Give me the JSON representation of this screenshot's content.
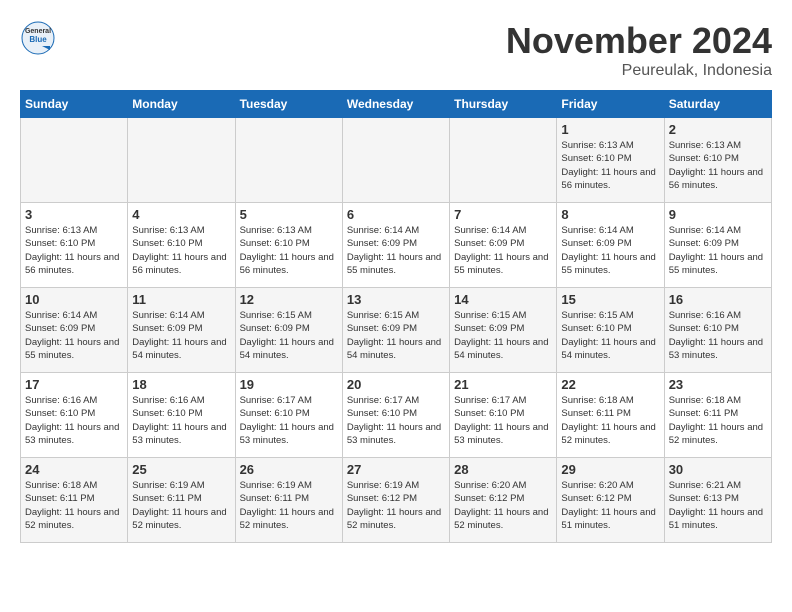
{
  "header": {
    "logo_general": "General",
    "logo_blue": "Blue",
    "month_title": "November 2024",
    "location": "Peureulak, Indonesia"
  },
  "days_of_week": [
    "Sunday",
    "Monday",
    "Tuesday",
    "Wednesday",
    "Thursday",
    "Friday",
    "Saturday"
  ],
  "weeks": [
    [
      {
        "day": "",
        "info": ""
      },
      {
        "day": "",
        "info": ""
      },
      {
        "day": "",
        "info": ""
      },
      {
        "day": "",
        "info": ""
      },
      {
        "day": "",
        "info": ""
      },
      {
        "day": "1",
        "info": "Sunrise: 6:13 AM\nSunset: 6:10 PM\nDaylight: 11 hours and 56 minutes."
      },
      {
        "day": "2",
        "info": "Sunrise: 6:13 AM\nSunset: 6:10 PM\nDaylight: 11 hours and 56 minutes."
      }
    ],
    [
      {
        "day": "3",
        "info": "Sunrise: 6:13 AM\nSunset: 6:10 PM\nDaylight: 11 hours and 56 minutes."
      },
      {
        "day": "4",
        "info": "Sunrise: 6:13 AM\nSunset: 6:10 PM\nDaylight: 11 hours and 56 minutes."
      },
      {
        "day": "5",
        "info": "Sunrise: 6:13 AM\nSunset: 6:10 PM\nDaylight: 11 hours and 56 minutes."
      },
      {
        "day": "6",
        "info": "Sunrise: 6:14 AM\nSunset: 6:09 PM\nDaylight: 11 hours and 55 minutes."
      },
      {
        "day": "7",
        "info": "Sunrise: 6:14 AM\nSunset: 6:09 PM\nDaylight: 11 hours and 55 minutes."
      },
      {
        "day": "8",
        "info": "Sunrise: 6:14 AM\nSunset: 6:09 PM\nDaylight: 11 hours and 55 minutes."
      },
      {
        "day": "9",
        "info": "Sunrise: 6:14 AM\nSunset: 6:09 PM\nDaylight: 11 hours and 55 minutes."
      }
    ],
    [
      {
        "day": "10",
        "info": "Sunrise: 6:14 AM\nSunset: 6:09 PM\nDaylight: 11 hours and 55 minutes."
      },
      {
        "day": "11",
        "info": "Sunrise: 6:14 AM\nSunset: 6:09 PM\nDaylight: 11 hours and 54 minutes."
      },
      {
        "day": "12",
        "info": "Sunrise: 6:15 AM\nSunset: 6:09 PM\nDaylight: 11 hours and 54 minutes."
      },
      {
        "day": "13",
        "info": "Sunrise: 6:15 AM\nSunset: 6:09 PM\nDaylight: 11 hours and 54 minutes."
      },
      {
        "day": "14",
        "info": "Sunrise: 6:15 AM\nSunset: 6:09 PM\nDaylight: 11 hours and 54 minutes."
      },
      {
        "day": "15",
        "info": "Sunrise: 6:15 AM\nSunset: 6:10 PM\nDaylight: 11 hours and 54 minutes."
      },
      {
        "day": "16",
        "info": "Sunrise: 6:16 AM\nSunset: 6:10 PM\nDaylight: 11 hours and 53 minutes."
      }
    ],
    [
      {
        "day": "17",
        "info": "Sunrise: 6:16 AM\nSunset: 6:10 PM\nDaylight: 11 hours and 53 minutes."
      },
      {
        "day": "18",
        "info": "Sunrise: 6:16 AM\nSunset: 6:10 PM\nDaylight: 11 hours and 53 minutes."
      },
      {
        "day": "19",
        "info": "Sunrise: 6:17 AM\nSunset: 6:10 PM\nDaylight: 11 hours and 53 minutes."
      },
      {
        "day": "20",
        "info": "Sunrise: 6:17 AM\nSunset: 6:10 PM\nDaylight: 11 hours and 53 minutes."
      },
      {
        "day": "21",
        "info": "Sunrise: 6:17 AM\nSunset: 6:10 PM\nDaylight: 11 hours and 53 minutes."
      },
      {
        "day": "22",
        "info": "Sunrise: 6:18 AM\nSunset: 6:11 PM\nDaylight: 11 hours and 52 minutes."
      },
      {
        "day": "23",
        "info": "Sunrise: 6:18 AM\nSunset: 6:11 PM\nDaylight: 11 hours and 52 minutes."
      }
    ],
    [
      {
        "day": "24",
        "info": "Sunrise: 6:18 AM\nSunset: 6:11 PM\nDaylight: 11 hours and 52 minutes."
      },
      {
        "day": "25",
        "info": "Sunrise: 6:19 AM\nSunset: 6:11 PM\nDaylight: 11 hours and 52 minutes."
      },
      {
        "day": "26",
        "info": "Sunrise: 6:19 AM\nSunset: 6:11 PM\nDaylight: 11 hours and 52 minutes."
      },
      {
        "day": "27",
        "info": "Sunrise: 6:19 AM\nSunset: 6:12 PM\nDaylight: 11 hours and 52 minutes."
      },
      {
        "day": "28",
        "info": "Sunrise: 6:20 AM\nSunset: 6:12 PM\nDaylight: 11 hours and 52 minutes."
      },
      {
        "day": "29",
        "info": "Sunrise: 6:20 AM\nSunset: 6:12 PM\nDaylight: 11 hours and 51 minutes."
      },
      {
        "day": "30",
        "info": "Sunrise: 6:21 AM\nSunset: 6:13 PM\nDaylight: 11 hours and 51 minutes."
      }
    ]
  ]
}
